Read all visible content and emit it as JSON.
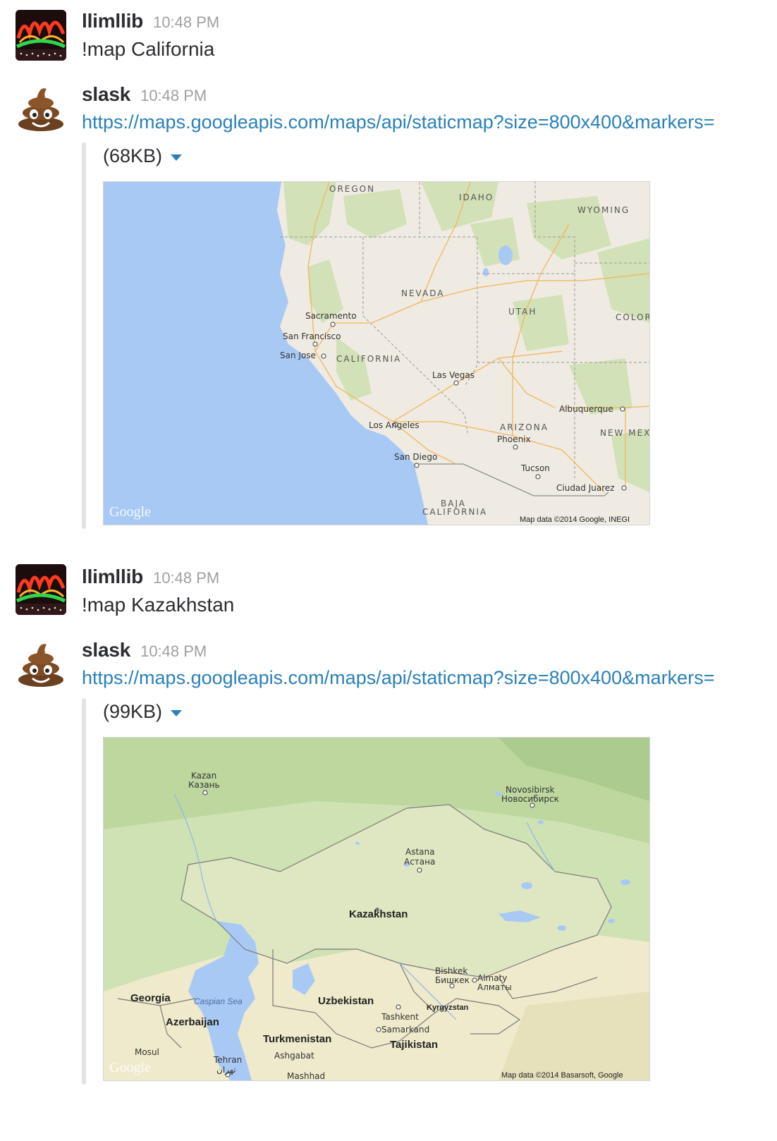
{
  "messages": [
    {
      "user": "llimllib",
      "time": "10:48 PM",
      "text": "!map California"
    },
    {
      "user": "slask",
      "time": "10:48 PM",
      "link": "https://maps.googleapis.com/maps/api/staticmap?size=800x400&markers=",
      "size": "(68KB)",
      "map": {
        "states": [
          "OREGON",
          "IDAHO",
          "WYOMING",
          "NEVADA",
          "UTAH",
          "COLOR",
          "CALIFORNIA",
          "ARIZONA",
          "NEW MEX",
          "BAJA",
          "CALIFORNIA"
        ],
        "cities": [
          "Sacramento",
          "San Francisco",
          "San Jose",
          "Las Vegas",
          "Albuquerque",
          "Los Angeles",
          "Phoenix",
          "San Diego",
          "Tucson",
          "Ciudad Juarez"
        ],
        "logo": "Google",
        "copyright": "Map data ©2014 Google, INEGI"
      }
    },
    {
      "user": "llimllib",
      "time": "10:48 PM",
      "text": "!map Kazakhstan"
    },
    {
      "user": "slask",
      "time": "10:48 PM",
      "link": "https://maps.googleapis.com/maps/api/staticmap?size=800x400&markers=",
      "size": "(99KB)",
      "map": {
        "cities": [
          "Kazan",
          "Казань",
          "Novosibirsk",
          "Новосибирск",
          "Astana",
          "Астана",
          "Bishkek",
          "Бишкек",
          "Almaty",
          "Алматы",
          "Tashkent",
          "Samarkand",
          "Ashgabat",
          "Tehran",
          "تهران",
          "Mosul",
          "Mashhad"
        ],
        "countries": [
          "Kazakhstan",
          "Georgia",
          "Azerbaijan",
          "Uzbekistan",
          "Kyrgyzstan",
          "Turkmenistan",
          "Tajikistan"
        ],
        "sea": "Caspian Sea",
        "logo": "Google",
        "copyright": "Map data ©2014 Basarsoft, Google"
      }
    }
  ],
  "colors": {
    "link": "#2a80b9",
    "ocean": "#a9c9f5",
    "land": "#efebe2",
    "green": "#cde0b0",
    "time": "#a0a0a2"
  }
}
